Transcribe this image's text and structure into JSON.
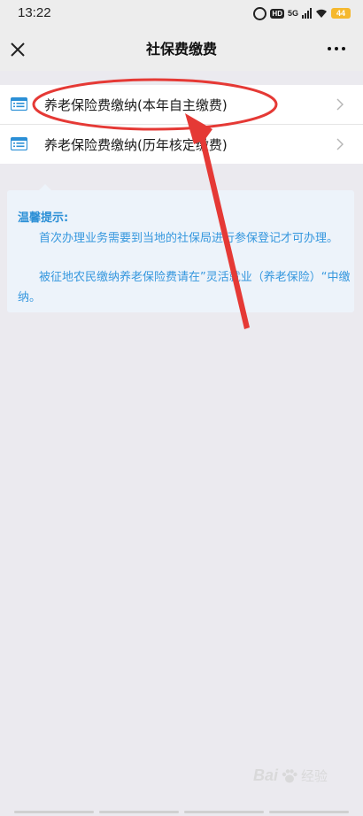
{
  "status_bar": {
    "time": "13:22",
    "hd_badge": "HD",
    "network": "5G",
    "battery": "44"
  },
  "nav": {
    "title": "社保费缴费",
    "close_icon": "close-icon",
    "more_icon": "more-icon"
  },
  "menu": {
    "items": [
      {
        "label": "养老保险费缴纳(本年自主缴费)",
        "icon": "list-icon"
      },
      {
        "label": "养老保险费缴纳(历年核定缴费)",
        "icon": "list-icon"
      }
    ]
  },
  "tips": {
    "title": "温馨提示:",
    "paragraphs": [
      "首次办理业务需要到当地的社保局进行参保登记才可办理。",
      "被征地农民缴纳养老保险费请在”灵活就业（养老保险）“中缴纳。"
    ]
  },
  "watermark": {
    "brand": "Bai",
    "suffix": "经验"
  },
  "colors": {
    "accent": "#2b8fd6",
    "annotation": "#e53935",
    "tip_background": "#edf3fa"
  }
}
